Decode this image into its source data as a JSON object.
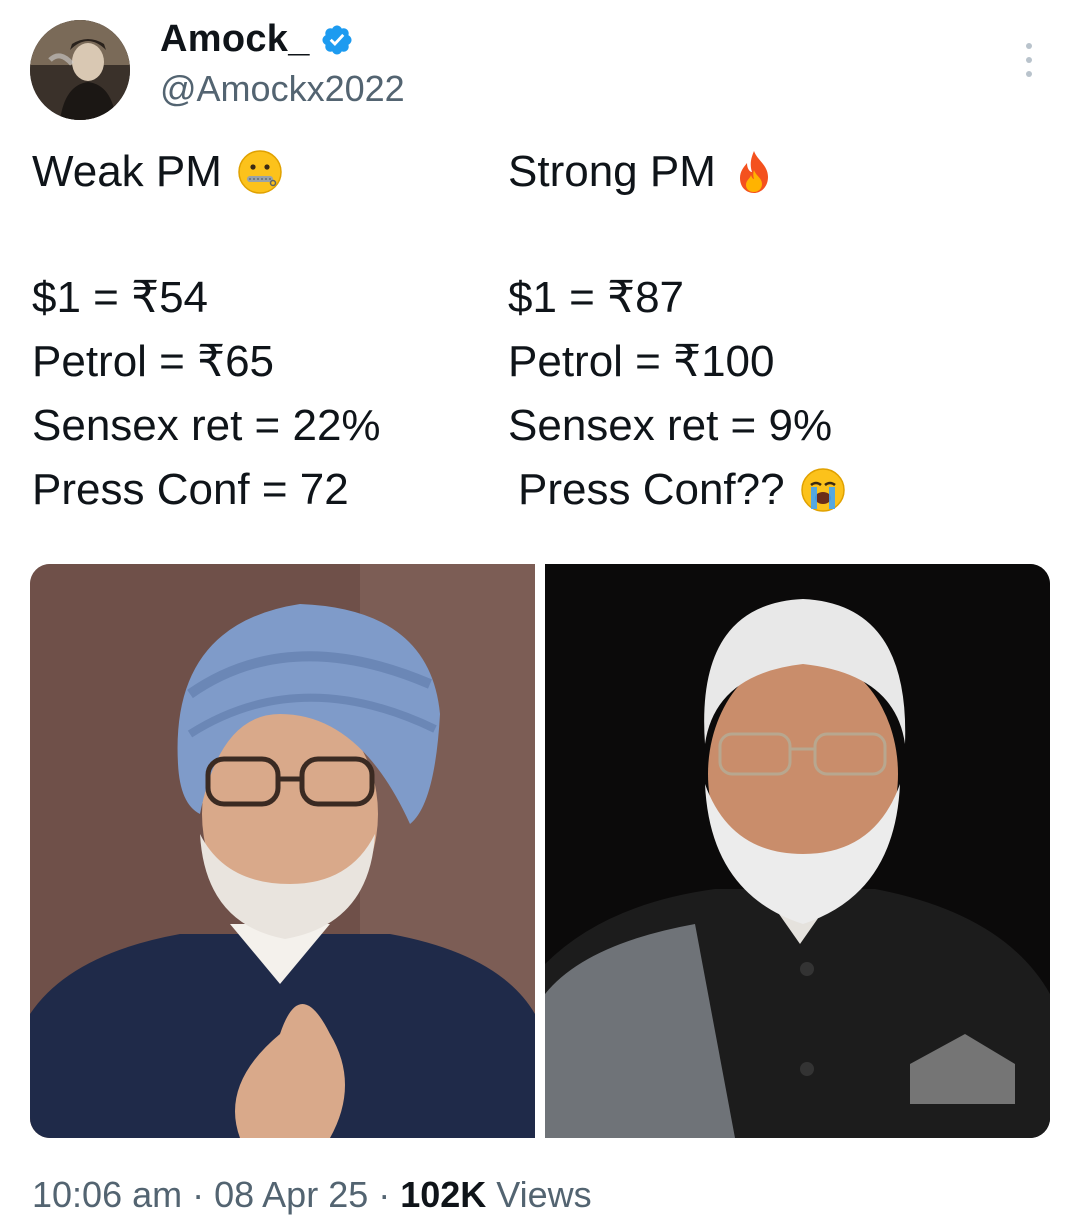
{
  "author": {
    "display_name": "Amock_",
    "handle": "@Amockx2022",
    "verified": true
  },
  "tweet": {
    "left": {
      "heading": "Weak PM",
      "heading_emoji": "zipper-mouth-face",
      "lines": [
        "$1 = ₹54",
        "Petrol = ₹65",
        "Sensex ret = 22%",
        "Press Conf = 72"
      ]
    },
    "right": {
      "heading": "Strong PM",
      "heading_emoji": "fire",
      "lines": [
        "$1 = ₹87",
        "Petrol = ₹100",
        "Sensex ret = 9%",
        "Press Conf??"
      ],
      "last_line_emoji": "loudly-crying-face"
    }
  },
  "meta": {
    "time": "10:06 am",
    "sep1": " · ",
    "date": "08 Apr 25",
    "sep2": " · ",
    "views_count": "102K",
    "views_label": " Views"
  },
  "colors": {
    "text": "#0f1419",
    "secondary": "#536471",
    "verified": "#1d9bf0"
  }
}
